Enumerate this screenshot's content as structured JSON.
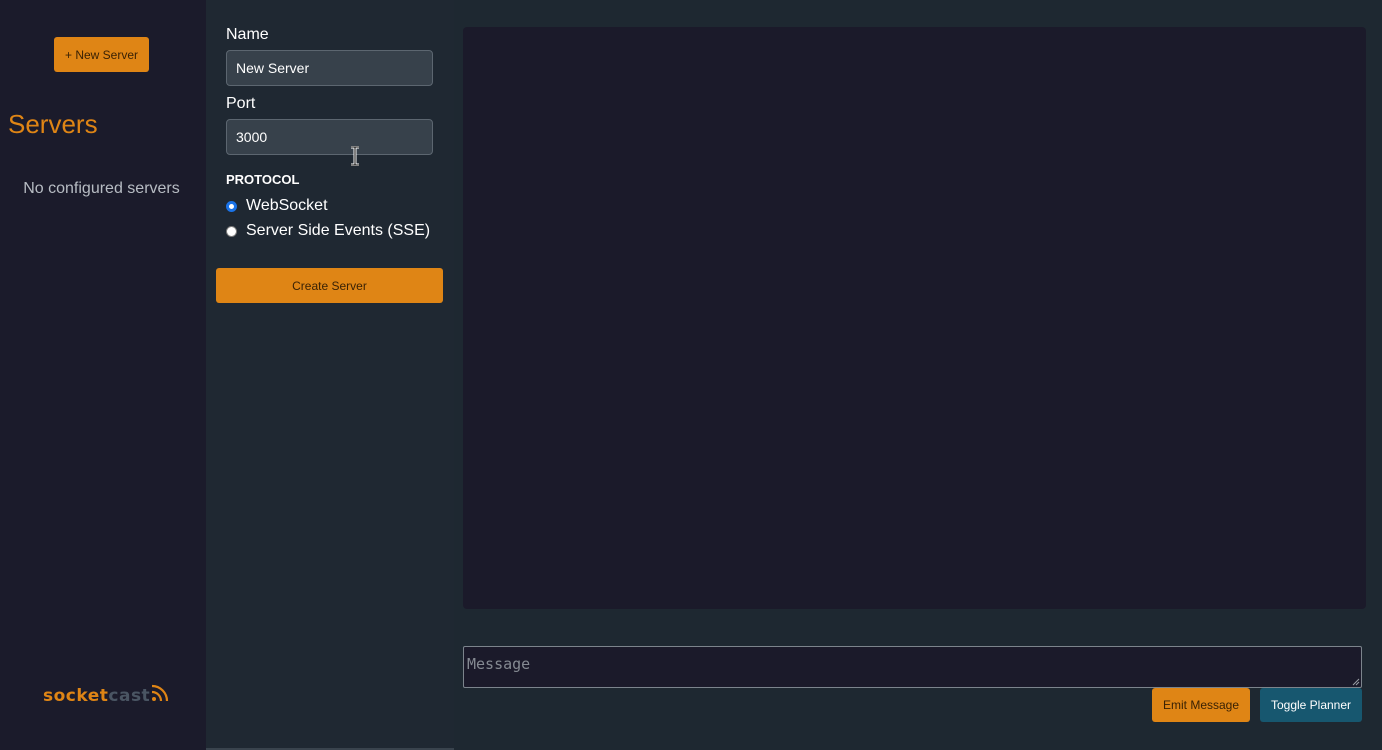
{
  "sidebar": {
    "new_server_label": "+ New Server",
    "title": "Servers",
    "empty_text": "No configured servers",
    "logo": {
      "part1": "socket",
      "part2": "cast",
      "icon": "broadcast-icon"
    }
  },
  "form": {
    "name_label": "Name",
    "name_value": "New Server",
    "port_label": "Port",
    "port_value": "3000",
    "protocol_label": "PROTOCOL",
    "protocol_options": [
      {
        "label": "WebSocket",
        "checked": true
      },
      {
        "label": "Server Side Events (SSE)",
        "checked": false
      }
    ],
    "create_label": "Create Server"
  },
  "composer": {
    "message_placeholder": "Message",
    "emit_label": "Emit Message",
    "toggle_label": "Toggle Planner"
  },
  "colors": {
    "accent": "#df8515",
    "secondary_button": "#17576f",
    "sidebar_bg": "#1b1b2b",
    "panel_bg": "#1f2832",
    "output_bg": "#1b1a2a"
  }
}
